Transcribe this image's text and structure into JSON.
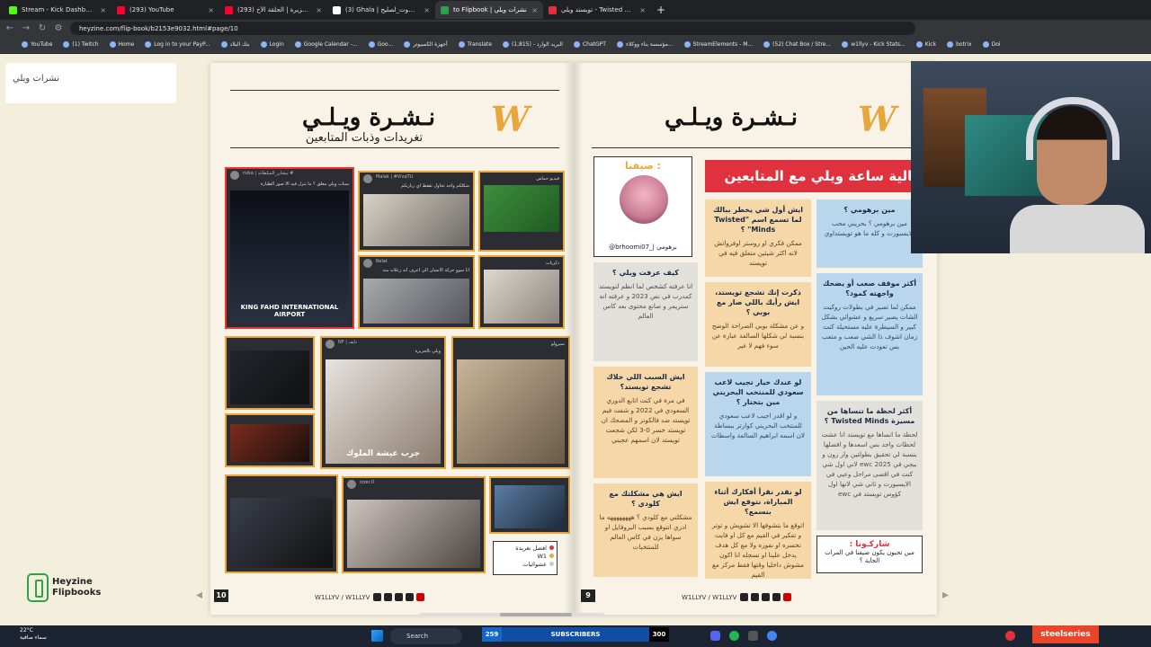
{
  "browser": {
    "tabs": [
      {
        "title": "Stream - Kick Dashboard",
        "color": "#53fc18",
        "active": false
      },
      {
        "title": "(293) YouTube",
        "color": "#ff0033",
        "active": false
      },
      {
        "title": "(293) نهاية الجزيرة | الحلقة الأخ...",
        "color": "#ff0033",
        "active": false
      },
      {
        "title": "(3) Ghala | صوت_لصليح# on X",
        "color": "#ffffff",
        "active": false
      },
      {
        "title": "to Flipbook | نشرات ويلي",
        "color": "#2ea24b",
        "active": true
      },
      {
        "title": "تويستد ويلي - Twisted Minds",
        "color": "#e0323e",
        "active": false
      }
    ],
    "new_tab": "+",
    "url": "heyzine.com/flip-book/b2153e9032.html#page/10",
    "bookmarks": [
      "YouTube",
      "(1) Twitch",
      "Home",
      "Log in to your PayP...",
      "بنك البلاد",
      "Login",
      "Google Calendar -...",
      "Goo...",
      "أجهزة الكمبيوتر",
      "Translate",
      "البريد الوارد - (1,815)",
      "ChatGPT",
      "مؤسسة بناء ووكلاء...",
      "StreamElements - M...",
      "(52) Chat Box / Stre...",
      "w1llyv - Kick Stats...",
      "Kick",
      "botrix",
      "Doi"
    ]
  },
  "sidepanel": {
    "label": "نشرات ويلي"
  },
  "page_left": {
    "title": "نـشـرة ويـلـي",
    "subtitle": "تغريدات وذبات المتابعين",
    "page_number": "10",
    "footer": "W1LLYV / W1LLYV",
    "thumbs": [
      {
        "caption": "سناب ويلي معلق ؟ ما تنزل فيه الا صور الطيارة",
        "meta": "rizka | نيشان_السلطانة #",
        "big": "KING FAHD INTERNATIONAL AIRPORT"
      },
      {
        "caption": "شكلكم واجد تحاول تقفط اي زيارتكم",
        "meta": "Malak | #VivaTU",
        "big": ""
      },
      {
        "caption": "فيديو حماس",
        "meta": "",
        "big": ""
      },
      {
        "caption": "انا سوو حركة الانسان الي اعرف انه زعلانه منه",
        "meta": "Relat",
        "big": ""
      },
      {
        "caption": "ذكريات",
        "meta": "",
        "big": ""
      },
      {
        "caption": "",
        "meta": "",
        "big": ""
      },
      {
        "caption": "",
        "meta": "",
        "big": ""
      },
      {
        "caption": "ويلي بالجزيرة",
        "meta": "NF | نايف",
        "big": "جرب عيشة الملوك"
      },
      {
        "caption": "سيرولو",
        "meta": "",
        "big": ""
      },
      {
        "caption": "",
        "meta": "",
        "big": ""
      },
      {
        "caption": "",
        "meta": "izzer.0",
        "big": ""
      },
      {
        "caption": "",
        "meta": "",
        "big": ""
      }
    ],
    "tweet_card": {
      "lines": [
        "افضل تغريدة",
        "W1",
        "عشوائيات"
      ]
    }
  },
  "page_right": {
    "title": "نـشـرة ويـلـي",
    "page_number": "9",
    "footer": "W1LLYV / W1LLYV",
    "banner": "فعالية ساعة ويلي مع المتابعين",
    "guest": {
      "label": "ضيفنا :",
      "handle": "@brhoomi07_| برهومي"
    },
    "cards": [
      {
        "style": "blue",
        "q": "مين برهومي ؟",
        "a": "مين برهومي ؟ بحريني محب للايسبورت و كله ما هو تويستداوي"
      },
      {
        "style": "orange",
        "q": "ايش أول شي يخطر ببالك لما تسمع اسم \"Twisted Minds\" ؟",
        "a": "ممكن فكري او روستر اوفرواتش لانه اكثر شيئين متعلق فيه في تويستد"
      },
      {
        "style": "gray",
        "q": "كيف عرفت ويلي ؟",
        "a": "انا عرفته كشخص لما انظم لتويستد كمدرب في نص 2023 و عرفته انه ستريمر و صانع محتوى بعد كاس العالم"
      },
      {
        "style": "blue",
        "q": "أكثر موقف صعب أو يضحك واجهته كمود؟",
        "a": "ممكن لما تصير في بطولات روكيت الشات يصير سريع و عشوائي بشكل كبير و السيطرة عليه مستحيلة كنت زمان اشوف ذا الشي صعب و متعب بس تعودت عليه الحين"
      },
      {
        "style": "orange",
        "q": "ذكرت إنك تشجع تويستد، ايش رأيك باللي صار مع بوبي ؟",
        "a": "و عن مشكلة بوبي الصراحة الوضح بنسبة لي شكلها السالفة عبارة عن سوء فهم لا غير"
      },
      {
        "style": "orange",
        "q": "ايش السبب اللي خلاك تشجع تويستد؟",
        "a": "في مرة في كنت اتابع الدوري السعودي في 2022 و شفت فيم تويستد ضد فالكونز و المضحك ان تويستد خسر 0-3 لكن شجعت تويستد لان اسمهم عجبني"
      },
      {
        "style": "blue",
        "q": "لو عندك خيار تجيب لاعب سعودي للمنتخب البحريني مين بتختار ؟",
        "a": "و لو اقدر اجيب لاعب سعودي للمنتخب البحريني كوارتز ببساطة لان اسمه ابراهيم السالفة واسطات"
      },
      {
        "style": "gray",
        "q": "أكثر لحظة ما تنساها من مسيرة Twisted Minds ؟",
        "a": "لحظة ما انساها مع تويستد انا عشت لحظات واجد بس اسعدها و افضلها بنسبة لي تحقيق بطولتين وار زون و ببجي في 2025 ewc لاني اول شي كنت في اقصى مراحل وعيي في الايسبورت و ثاني شي لانها اول كؤوس تويستد في ewc"
      },
      {
        "style": "orange",
        "q": "ايش هي مشكلتك مع كلودي ؟",
        "a": "مشكلتي مع كلودي ؟ ههههههههه ما ادري انتوقع بسبب البروفايل او سواها يزن في كاس العالم للمنتخبات"
      },
      {
        "style": "orange",
        "q": "لو نقدر نقرأ أفكارك أثناء المباراة، نتوقع ايش بنسمع؟",
        "a": "اتوقع ما بتشوفها الا تشويش و توتر و تفكير في القيم مع كل او فايت نخسره او نفوزه ولا مع كل هدف يدخل علينا او نسجله انا اكون مشوش داخليا وقتها فقط مركز مع القيم"
      }
    ],
    "sharkona": {
      "heading": "شاركـونا :",
      "text": "مين تحبون يكون ضيفنا في المرات الجاية ؟"
    }
  },
  "heyzine": {
    "line1": "Heyzine",
    "line2": "Flipbooks"
  },
  "taskbar": {
    "weather_temp": "22°C",
    "weather_desc": "سماء صافية",
    "search": "Search",
    "subs_count": "259",
    "subs_label": "SUBSCRIBERS",
    "subs_goal": "300",
    "steelseries": "steelseries"
  }
}
